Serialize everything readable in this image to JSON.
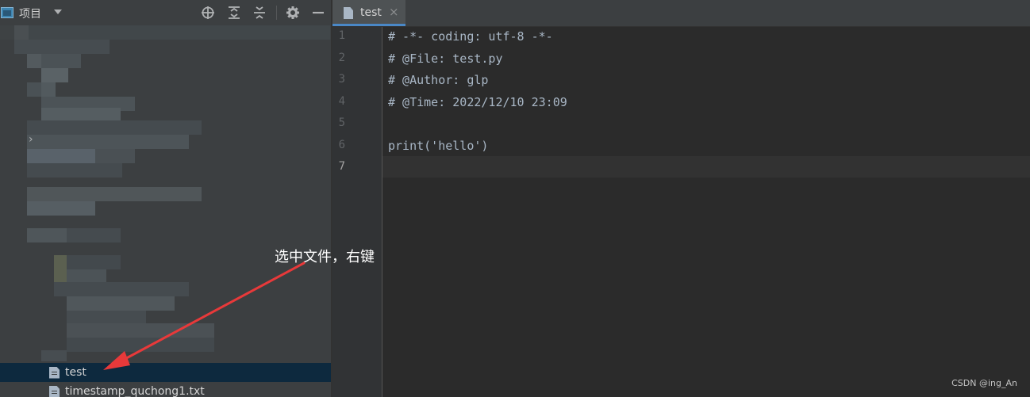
{
  "project_panel": {
    "title": "项目",
    "tree": {
      "selected_file": "test",
      "next_file": "timestamp_quchong1.txt"
    }
  },
  "annotation": {
    "text": "选中文件，右键",
    "arrow_color": "#e8393a"
  },
  "editor": {
    "tab_label": "test",
    "tab_close": "×",
    "current_line": 7,
    "line_numbers": [
      "1",
      "2",
      "3",
      "4",
      "5",
      "6",
      "7"
    ],
    "lines": [
      "# -*- coding: utf-8 -*-",
      "# @File: test.py",
      "# @Author: glp",
      "# @Time: 2022/12/10 23:09",
      "",
      "print('hello')",
      ""
    ]
  },
  "watermark": "CSDN @ing_An",
  "colors": {
    "accent": "#4a88c7",
    "selection": "#0d293e"
  }
}
